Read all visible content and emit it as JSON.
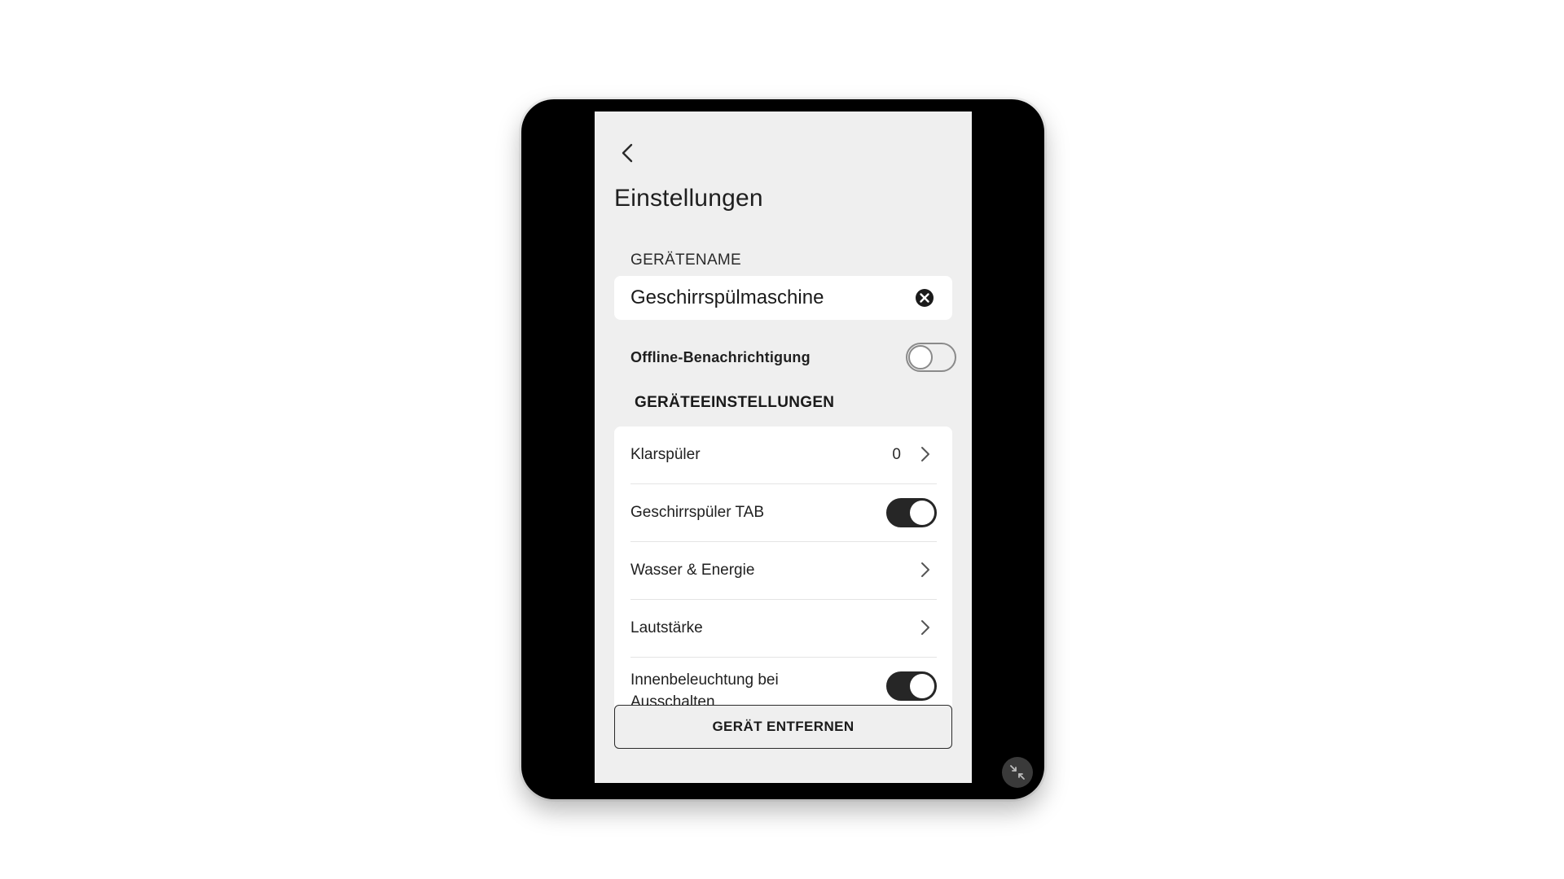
{
  "header": {
    "title": "Einstellungen"
  },
  "device_name": {
    "section_label": "GERÄTENAME",
    "value": "Geschirrspülmaschine"
  },
  "offline_notification": {
    "label": "Offline-Benachrichtigung",
    "enabled": false
  },
  "device_settings": {
    "heading": "GERÄTEEINSTELLUNGEN",
    "items": [
      {
        "label": "Klarspüler",
        "value": "0",
        "control": "chevron"
      },
      {
        "label": "Geschirrspüler TAB",
        "control": "toggle",
        "enabled": true
      },
      {
        "label": "Wasser & Energie",
        "control": "chevron"
      },
      {
        "label": "Lautstärke",
        "control": "chevron"
      },
      {
        "label": "Innenbeleuchtung bei Ausschalten",
        "control": "toggle",
        "enabled": true
      }
    ]
  },
  "actions": {
    "remove_label": "GERÄT ENTFERNEN"
  },
  "icons": {
    "back": "chevron-left-icon",
    "clear": "close-circle-icon",
    "row_arrow": "chevron-right-icon",
    "collapse": "collapse-arrows-icon"
  },
  "colors": {
    "screen_bg": "#efefef",
    "card_bg": "#ffffff",
    "toggle_on": "#262626",
    "device_frame": "#000000"
  }
}
